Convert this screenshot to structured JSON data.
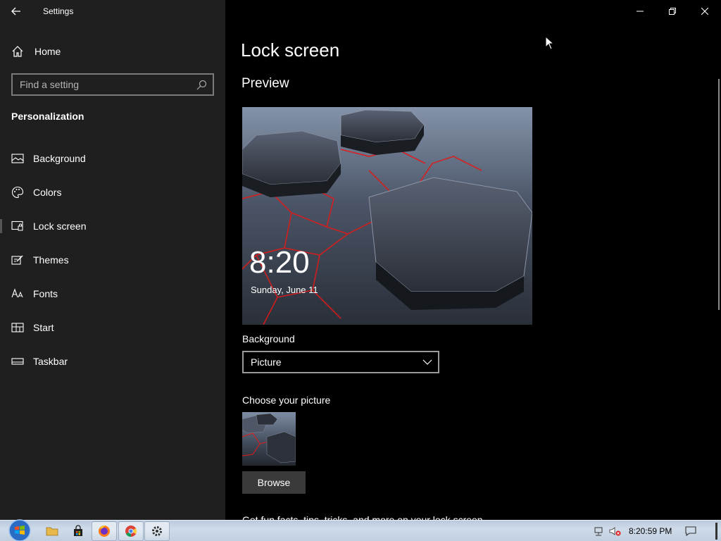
{
  "window": {
    "app_title": "Settings",
    "controls": [
      "minimize",
      "restore",
      "close"
    ]
  },
  "sidebar": {
    "home_label": "Home",
    "search_placeholder": "Find a setting",
    "section_label": "Personalization",
    "items": [
      {
        "label": "Background",
        "icon": "picture-icon"
      },
      {
        "label": "Colors",
        "icon": "palette-icon"
      },
      {
        "label": "Lock screen",
        "icon": "lock-screen-icon",
        "active": true
      },
      {
        "label": "Themes",
        "icon": "brush-icon"
      },
      {
        "label": "Fonts",
        "icon": "font-icon"
      },
      {
        "label": "Start",
        "icon": "start-icon"
      },
      {
        "label": "Taskbar",
        "icon": "taskbar-icon"
      }
    ]
  },
  "main": {
    "page_title": "Lock screen",
    "preview_heading": "Preview",
    "preview_time": "8:20",
    "preview_date": "Sunday, June 11",
    "background_label": "Background",
    "background_value": "Picture",
    "choose_label": "Choose your picture",
    "browse_label": "Browse",
    "fun_facts_text": "Get fun facts, tips, tricks, and more on your lock screen"
  },
  "taskbar": {
    "apps": [
      "file-explorer-icon",
      "store-icon",
      "firefox-icon",
      "chrome-icon",
      "settings-icon"
    ],
    "clock": "8:20:59 PM"
  },
  "colors": {
    "sidebar_bg": "#1f1f1f",
    "main_bg": "#000000",
    "accent_red": "#e01a1a"
  }
}
